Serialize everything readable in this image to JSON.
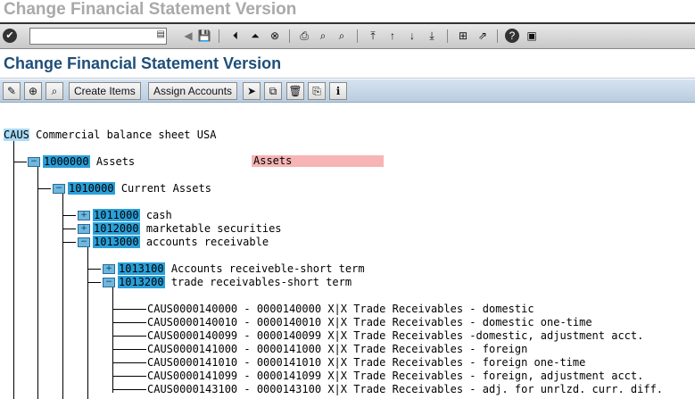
{
  "window": {
    "title": "Change Financial Statement Version"
  },
  "screen": {
    "title": "Change Financial Statement Version"
  },
  "command_field": {
    "value": ""
  },
  "app_toolbar": {
    "create_items": "Create Items",
    "assign_accounts": "Assign Accounts"
  },
  "tree": {
    "root": {
      "code": "CAUS",
      "text": "Commercial balance sheet USA"
    },
    "level1": {
      "code": "1000000",
      "text": "Assets",
      "extra": "Assets"
    },
    "level2": {
      "code": "1010000",
      "text": "Current Assets"
    },
    "level3": [
      {
        "code": "1011000",
        "text": "cash"
      },
      {
        "code": "1012000",
        "text": "marketable securities"
      },
      {
        "code": "1013000",
        "text": "accounts receivable"
      }
    ],
    "level4": [
      {
        "code": "1013100",
        "text": "Accounts receiveble-short term"
      },
      {
        "code": "1013200",
        "text": "trade receivables-short term"
      }
    ],
    "accounts": [
      {
        "range": "CAUS0000140000 - 0000140000",
        "debit": "X",
        "credit": "X",
        "text": "Trade Receivables - domestic"
      },
      {
        "range": "CAUS0000140010 - 0000140010",
        "debit": "X",
        "credit": "X",
        "text": "Trade Receivables - domestic one-time"
      },
      {
        "range": "CAUS0000140099 - 0000140099",
        "debit": "X",
        "credit": "X",
        "text": "Trade Receivables -domestic, adjustment acct."
      },
      {
        "range": "CAUS0000141000 - 0000141000",
        "debit": "X",
        "credit": "X",
        "text": "Trade Receivables - foreign"
      },
      {
        "range": "CAUS0000141010 - 0000141010",
        "debit": "X",
        "credit": "X",
        "text": "Trade Receivables - foreign one-time"
      },
      {
        "range": "CAUS0000141099 - 0000141099",
        "debit": "X",
        "credit": "X",
        "text": "Trade Receivables - foreign, adjustment acct."
      },
      {
        "range": "CAUS0000143100 - 0000143100",
        "debit": "X",
        "credit": "X",
        "text": "Trade Receivables - adj. for unrlzd. curr. diff."
      }
    ]
  },
  "colors": {
    "title_blue": "#1f4e79",
    "highlight": "#2a9fd8",
    "pink": "#f6b4b4"
  }
}
